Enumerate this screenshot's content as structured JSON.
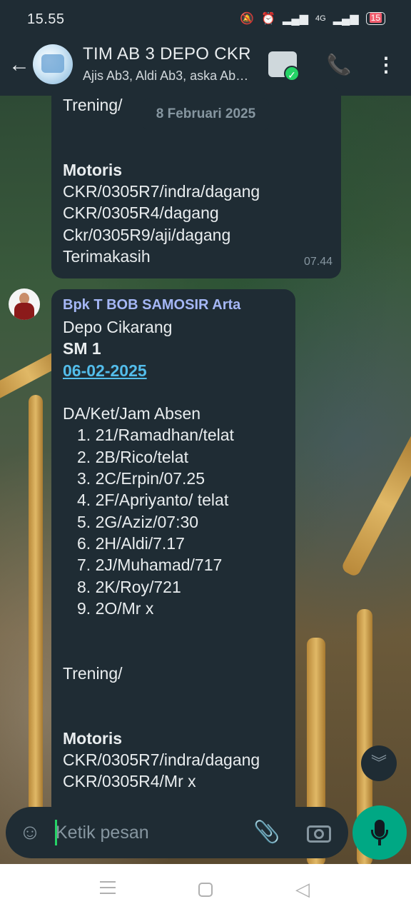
{
  "status_bar": {
    "time": "15.55",
    "network": "4G",
    "battery": "15"
  },
  "header": {
    "title": "TIM AB 3 DEPO CKR",
    "subtitle": "Ajis Ab3, Aldi Ab3, aska Ab…",
    "icons": [
      "back-arrow-icon",
      "group-avatar",
      "sticker-icon",
      "add-call-icon",
      "more-vert-icon"
    ]
  },
  "date_chip": "8 Februari 2025",
  "message1": {
    "lines": [
      {
        "text": "Trening/",
        "style": "normal"
      },
      {
        "text": "",
        "style": "normal"
      },
      {
        "text": "",
        "style": "normal"
      },
      {
        "text": "Motoris",
        "style": "bold"
      },
      {
        "text": "CKR/0305R7/indra/dagang",
        "style": "normal"
      },
      {
        "text": "CKR/0305R4/dagang",
        "style": "normal"
      },
      {
        "text": "Ckr/0305R9/aji/dagang",
        "style": "normal"
      },
      {
        "text": "Terimakasih",
        "style": "normal"
      }
    ],
    "time": "07.44"
  },
  "message2": {
    "sender": "Bpk T BOB SAMOSIR Arta",
    "line_depo": "Depo Cikarang",
    "line_sm": "SM 1",
    "line_date": "06-02-2025",
    "line_header": "DA/Ket/Jam Absen",
    "list": [
      "1. 21/Ramadhan/telat",
      "2. 2B/Rico/telat",
      "3. 2C/Erpin/07.25",
      "4. 2F/Apriyanto/ telat",
      "5. 2G/Aziz/07:30",
      "6. 2H/Aldi/7.17",
      "7. 2J/Muhamad/717",
      "8. 2K/Roy/721",
      "9. 2O/Mr x"
    ],
    "line_trening": "Trening/",
    "line_motoris": "Motoris",
    "line_m1": "CKR/0305R7/indra/dagang",
    "line_m2": "CKR/0305R4/Mr x"
  },
  "input": {
    "placeholder": "Ketik pesan"
  },
  "colors": {
    "bubble": "#1f2c34",
    "accent": "#00a884",
    "link": "#53bdeb",
    "sender": "#a5b7f6"
  }
}
